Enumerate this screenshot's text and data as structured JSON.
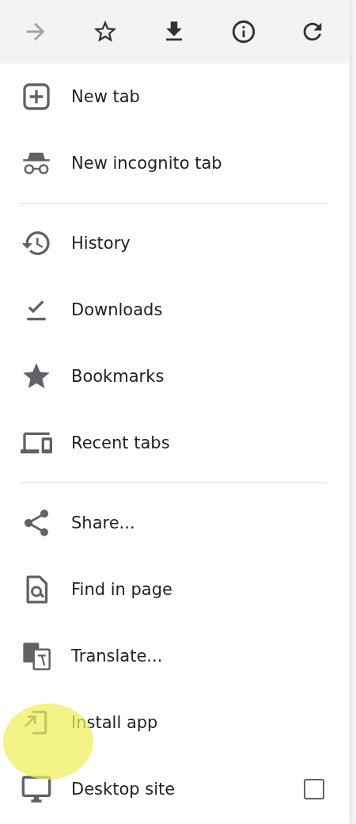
{
  "toolbar": {
    "buttons": [
      {
        "disabled": true
      },
      {
        "disabled": false
      },
      {
        "disabled": false
      },
      {
        "disabled": false
      },
      {
        "disabled": false
      }
    ]
  },
  "menu": {
    "groups": [
      {
        "items": [
          {
            "kind": "action",
            "label": "New tab",
            "touched": false
          },
          {
            "kind": "action",
            "label": "New incognito tab",
            "touched": false
          }
        ]
      },
      {
        "items": [
          {
            "kind": "action",
            "label": "History",
            "touched": false
          },
          {
            "kind": "action",
            "label": "Downloads",
            "touched": false
          },
          {
            "kind": "action",
            "label": "Bookmarks",
            "touched": false
          },
          {
            "kind": "action",
            "label": "Recent tabs",
            "touched": false
          }
        ]
      },
      {
        "items": [
          {
            "kind": "action",
            "label": "Share...",
            "touched": false
          },
          {
            "kind": "action",
            "label": "Find in page",
            "touched": false
          },
          {
            "kind": "action",
            "label": "Translate...",
            "touched": false
          },
          {
            "kind": "action",
            "label": "Install app",
            "touched": true
          },
          {
            "kind": "checkbox",
            "label": "Desktop site",
            "checked": false,
            "touched": false
          }
        ]
      }
    ]
  }
}
